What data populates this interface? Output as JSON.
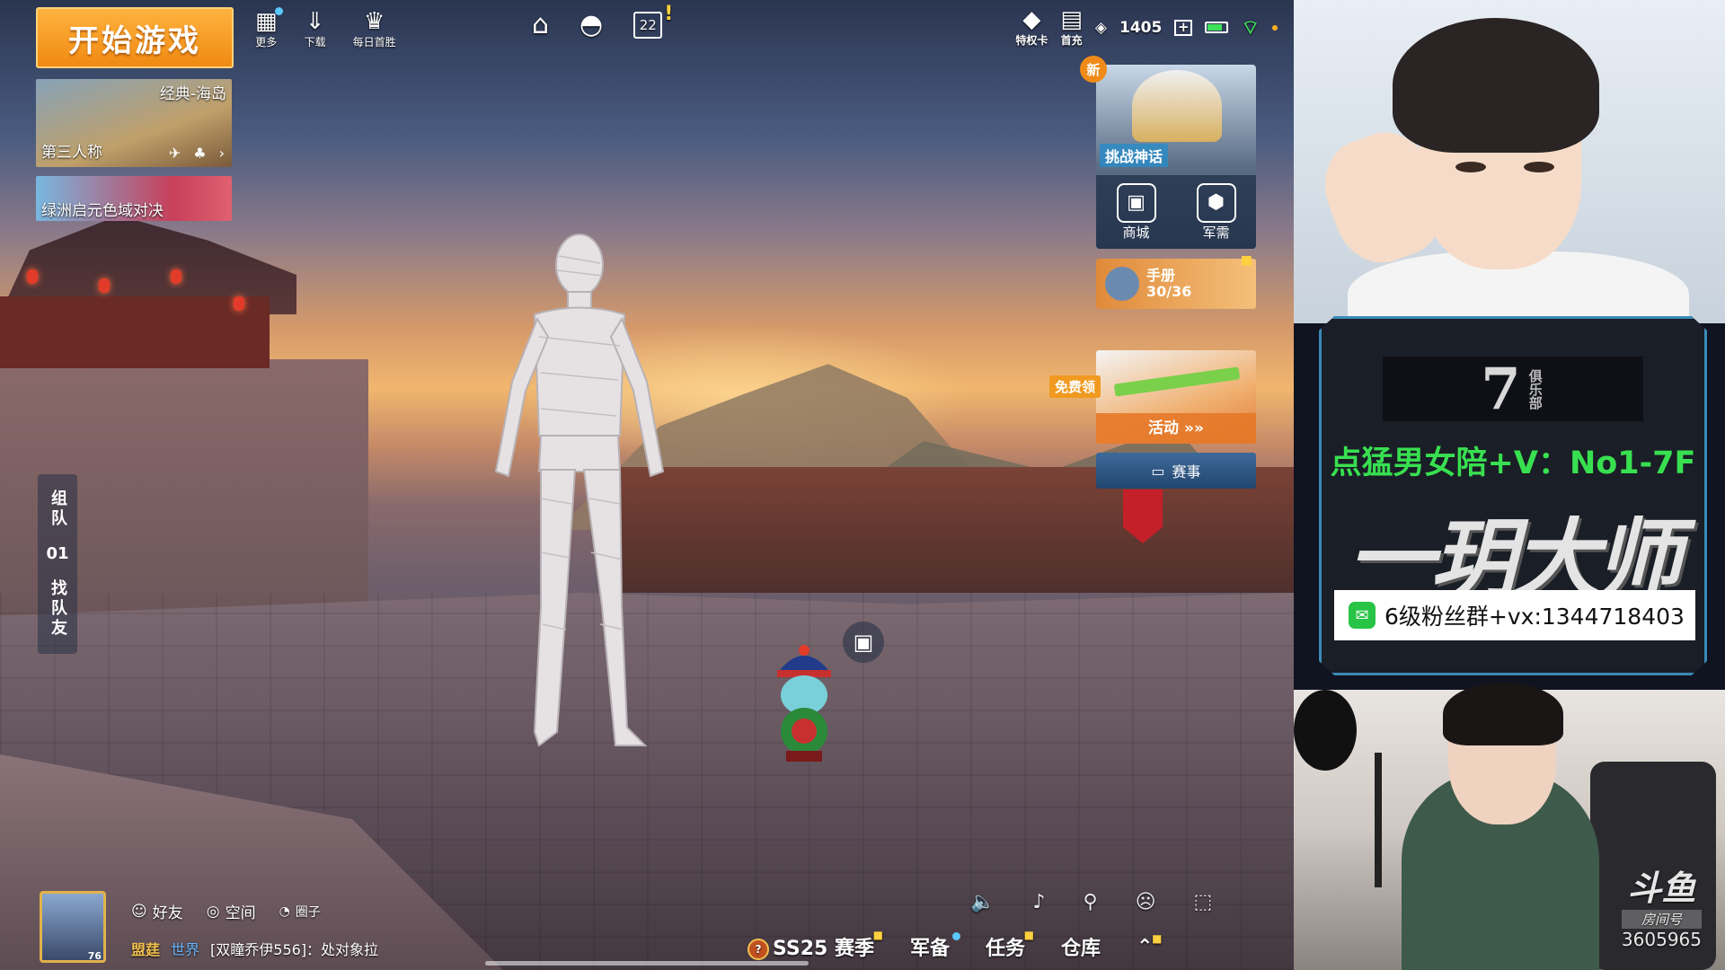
{
  "game": {
    "start_button": "开始游戏",
    "top_icons": [
      {
        "label": "更多",
        "icon": "grid-icon"
      },
      {
        "label": "下载",
        "icon": "download-icon"
      },
      {
        "label": "每日首胜",
        "icon": "trophy-icon"
      }
    ],
    "calendar_day": "22",
    "mode": {
      "title": "经典-海岛",
      "perspective": "第三人称"
    },
    "event_mode": "绿洲启元色域对决",
    "status": {
      "privilege": "特权卡",
      "first_recharge": "首充",
      "currency": "1405"
    },
    "side_panel": {
      "new_badge": "新",
      "banner": "挑战神话",
      "shop": "商城",
      "supply": "军需"
    },
    "manual": {
      "title": "手册",
      "progress": "30/36"
    },
    "activity": {
      "free_tag": "免费领",
      "label": "活动 »»"
    },
    "match_label": "赛事",
    "team": {
      "team_label": "组队",
      "team_count": "01",
      "find_label": "找队友"
    },
    "social": {
      "friends": "好友",
      "space": "空间",
      "circle": "圈子"
    },
    "avatar_level": "76",
    "chat": {
      "guild": "盟莛",
      "channel": "世界",
      "message": "[双瞳乔伊556]：处对象拉"
    },
    "bottom_menu": {
      "season": "SS25 赛季",
      "armory": "军备",
      "tasks": "任务",
      "warehouse": "仓库"
    }
  },
  "stream": {
    "promo": {
      "logo_mark": "7",
      "logo_club": "俱乐部",
      "slogan": "点猛男女陪+V：No1-7F",
      "brand": "一玥大师",
      "wechat": "6级粉丝群+vx:1344718403"
    },
    "douyu": {
      "logo": "斗鱼",
      "room_label": "房间号",
      "room_number": "3605965"
    }
  }
}
